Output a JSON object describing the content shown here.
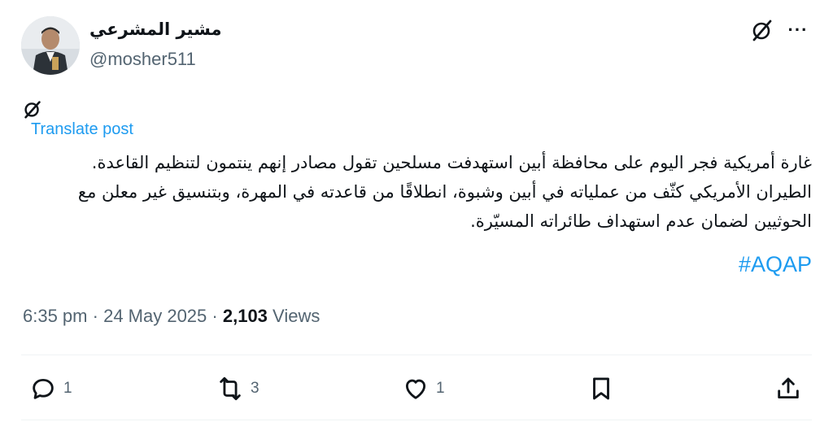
{
  "author": {
    "display_name": "مشير المشرعي",
    "handle": "@mosher511"
  },
  "header": {
    "grok_icon": "grok-icon",
    "more_icon": "more-icon",
    "more_glyph": "···"
  },
  "post": {
    "translate_label": "Translate post",
    "line1": "غارة أمريكية فجر اليوم على محافظة أبين استهدفت مسلحين تقول مصادر إنهم ينتمون لتنظيم القاعدة.",
    "line2": "الطيران الأمريكي كثّف من عملياته في أبين وشبوة، انطلاقًا من قاعدته في المهرة، وبتنسيق غير معلن مع الحوثيين لضمان عدم استهداف طائراته المسيّرة.",
    "hashtag": "#AQAP"
  },
  "meta": {
    "time": "6:35 pm",
    "sep1": "·",
    "date": "24 May 2025",
    "sep2": "·",
    "views_count": "2,103",
    "views_label": "Views"
  },
  "actions": {
    "reply_count": "1",
    "repost_count": "3",
    "like_count": "1"
  },
  "colors": {
    "accent": "#1d9bf0",
    "secondary_text": "#536471",
    "primary_text": "#0f1419",
    "divider": "#eff3f4"
  }
}
